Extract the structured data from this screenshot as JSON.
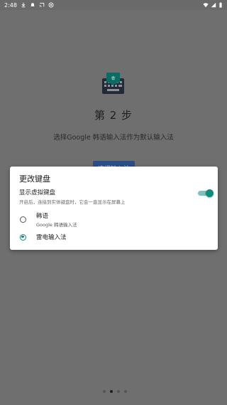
{
  "status_bar": {
    "time": "2:48",
    "icons": [
      "download-icon",
      "notification-icon",
      "cast-icon",
      "settings-circle-icon",
      "wifi-icon",
      "signal-icon",
      "battery-icon"
    ]
  },
  "setup": {
    "icon": "keyboard-icon",
    "step_title": "第 2 步",
    "description": "选择Google 韩语输入法作为默认输入法",
    "select_button": "选择输入法",
    "pager_total": 4,
    "pager_active": 1
  },
  "dialog": {
    "title": "更改键盘",
    "toggle": {
      "label": "显示虚拟键盘",
      "sub": "开启后，连接到实体键盘时，它会一直显示在屏幕上",
      "on": true
    },
    "options": [
      {
        "label": "韩语",
        "sub": "Google 韩语输入法",
        "selected": false
      },
      {
        "label": "雷电输入法",
        "sub": "",
        "selected": true
      }
    ]
  },
  "colors": {
    "accent": "#12897d",
    "scrim": "#6f6f6f",
    "button_bg": "#2a4e86"
  }
}
